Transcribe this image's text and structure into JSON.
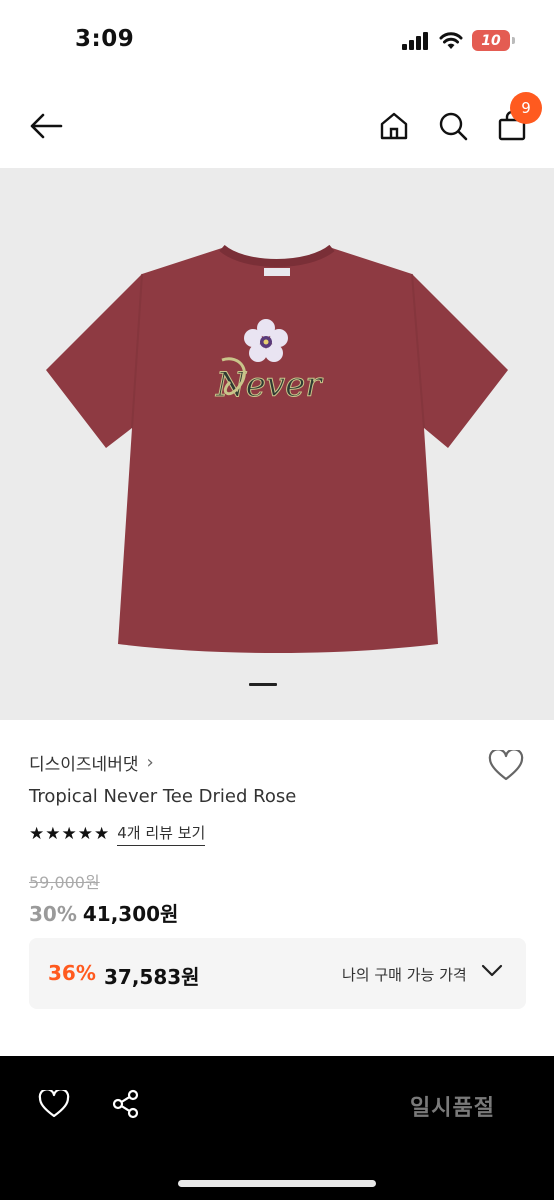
{
  "status_bar": {
    "time": "3:09",
    "battery": "10",
    "battery_color": "#e45c52"
  },
  "header": {
    "back_icon": "arrow-left-icon",
    "home_icon": "home-icon",
    "search_icon": "search-icon",
    "bag_icon": "shopping-bag-icon",
    "cart_count": "9",
    "badge_color": "#ff5a1f"
  },
  "gallery": {
    "image": "tee-red-never-print",
    "current_slide": 1
  },
  "product": {
    "brand": "디스이즈네버댓",
    "brand_chevron": "›",
    "name": "Tropical Never Tee Dried Rose",
    "rating_stars": 5,
    "review_link": "4개 리뷰 보기",
    "original_price": "59,000원",
    "discount": "30%",
    "price": "41,300원"
  },
  "my_price": {
    "discount": "36%",
    "price": "37,583원",
    "label": "나의 구매 가능 가격",
    "accent": "#ff5a1f"
  },
  "bottom_bar": {
    "wish_icon": "heart-icon",
    "share_icon": "share-icon",
    "sold_out_label": "일시품절"
  }
}
